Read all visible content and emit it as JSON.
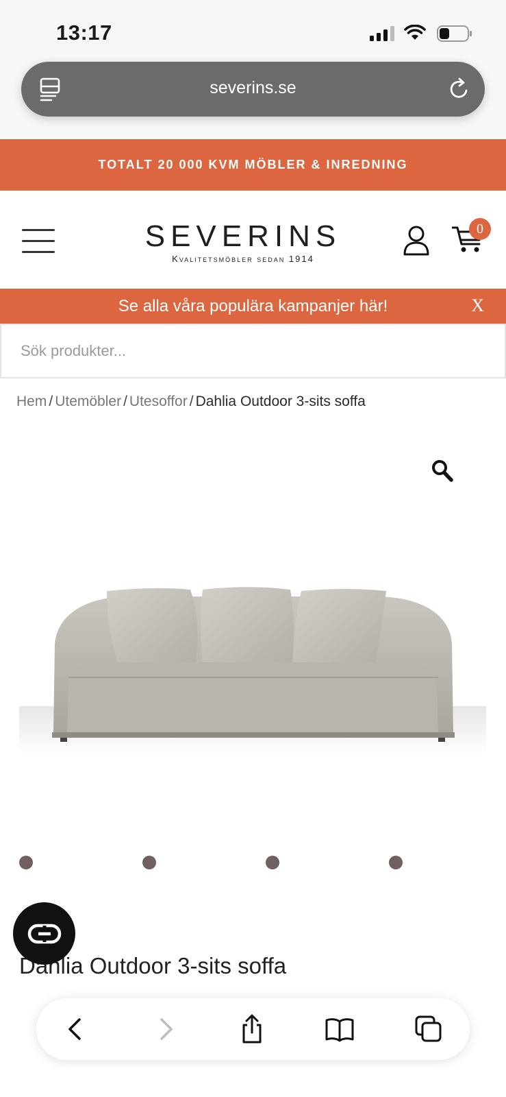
{
  "status_bar": {
    "time": "13:17"
  },
  "browser": {
    "url": "severins.se"
  },
  "promo_banner": {
    "text": "TOTALT 20 000 KVM MÖBLER & INREDNING",
    "color": "#dc6640"
  },
  "header": {
    "logo_main": "SEVERINS",
    "logo_sub": "Kvalitetsmöbler sedan 1914",
    "cart_count": "0"
  },
  "campaign_bar": {
    "text": "Se alla våra populära kampanjer här!",
    "close_label": "X"
  },
  "search": {
    "placeholder": "Sök produkter..."
  },
  "breadcrumb": {
    "items": [
      "Hem",
      "Utemöbler",
      "Utesoffor"
    ],
    "separator": "/",
    "current": "Dahlia Outdoor 3-sits soffa"
  },
  "product": {
    "title": "Dahlia Outdoor 3-sits soffa",
    "gallery_dot_count": 4
  },
  "toolbar": {
    "icons": [
      "back-icon",
      "forward-icon",
      "share-icon",
      "bookmarks-icon",
      "tabs-icon"
    ]
  }
}
